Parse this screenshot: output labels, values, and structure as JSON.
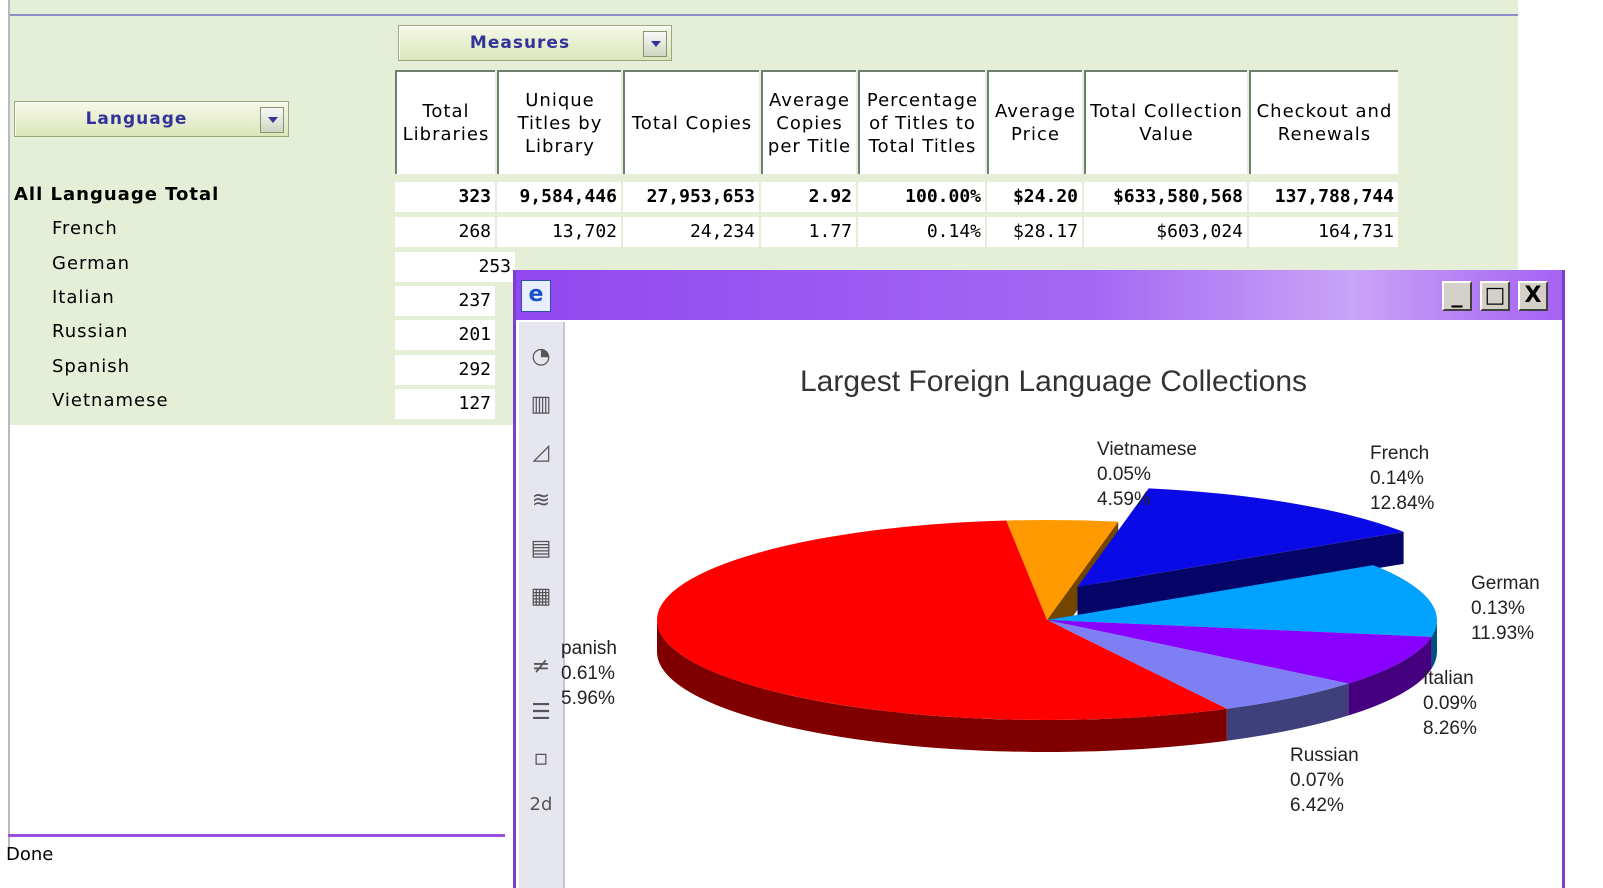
{
  "pivot": {
    "measures_label": "Measures",
    "language_label": "Language",
    "columns": [
      "Total Libraries",
      "Unique Titles by Library",
      "Total Copies",
      "Average Copies per Title",
      "Percentage of Titles to Total Titles",
      "Average Price",
      "Total Collection Value",
      "Checkout and Renewals"
    ],
    "rows": [
      {
        "label": "All Language Total",
        "values": [
          "323",
          "9,584,446",
          "27,953,653",
          "2.92",
          "100.00%",
          "$24.20",
          "$633,580,568",
          "137,788,744"
        ]
      },
      {
        "label": "French",
        "values": [
          "268",
          "13,702",
          "24,234",
          "1.77",
          "0.14%",
          "$28.17",
          "$603,024",
          "164,731"
        ]
      },
      {
        "label": "German",
        "values": [
          "253"
        ]
      },
      {
        "label": "Italian",
        "values": [
          "237"
        ]
      },
      {
        "label": "Russian",
        "values": [
          "201"
        ]
      },
      {
        "label": "Spanish",
        "values": [
          "292"
        ]
      },
      {
        "label": "Vietnamese",
        "values": [
          "127"
        ]
      }
    ]
  },
  "status": "Done",
  "popup": {
    "window_buttons": [
      "_",
      "□",
      "X"
    ]
  },
  "colors": {
    "french": "#0a0ae6",
    "german": "#00a2ff",
    "italian": "#8a00ff",
    "russian": "#7e7ef5",
    "spanish": "#ff0000",
    "vietnamese": "#ff9900"
  },
  "chart_data": {
    "type": "pie",
    "title": "Largest Foreign Language Collections",
    "slices": [
      {
        "name": "French",
        "values": [
          "0.14%",
          "12.84%"
        ],
        "share": 12.84
      },
      {
        "name": "German",
        "values": [
          "0.13%",
          "11.93%"
        ],
        "share": 11.93
      },
      {
        "name": "Italian",
        "values": [
          "0.09%",
          "8.26%"
        ],
        "share": 8.26
      },
      {
        "name": "Russian",
        "values": [
          "0.07%",
          "6.42%"
        ],
        "share": 6.42
      },
      {
        "name": "Spanish",
        "label": "panish",
        "values": [
          "0.61%",
          "5.96%"
        ],
        "share": 55.96
      },
      {
        "name": "Vietnamese",
        "values": [
          "0.05%",
          "4.59%"
        ],
        "share": 4.59
      }
    ]
  }
}
